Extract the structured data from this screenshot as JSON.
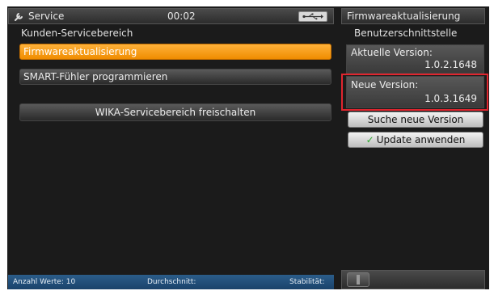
{
  "header": {
    "title": "Service",
    "time": "00:02",
    "icons": {
      "title_icon": "wrench-icon",
      "usb_icon": "usb-icon"
    }
  },
  "right_header": {
    "title": "Firmwareaktualisierung"
  },
  "left": {
    "section_title": "Kunden-Servicebereich",
    "items": [
      {
        "label": "Firmwareaktualisierung",
        "active": true
      },
      {
        "label": "SMART-Fühler programmieren",
        "active": false
      }
    ],
    "unlock_button": "WIKA-Servicebereich freischalten"
  },
  "right": {
    "section_title": "Benutzerschnittstelle",
    "current_version_label": "Aktuelle Version:",
    "current_version": "1.0.2.1648",
    "new_version_label": "Neue Version:",
    "new_version": "1.0.3.1649",
    "search_button": "Suche neue Version",
    "apply_button": "Update anwenden",
    "apply_icon": "checkmark-icon"
  },
  "status": {
    "count": "Anzahl Werte: 10",
    "average": "Durchschnitt:",
    "stability": "Stabilität:"
  },
  "colors": {
    "accent": "#f5950b",
    "highlight_frame": "#e0252e",
    "statusbar": "#1f4c78"
  }
}
